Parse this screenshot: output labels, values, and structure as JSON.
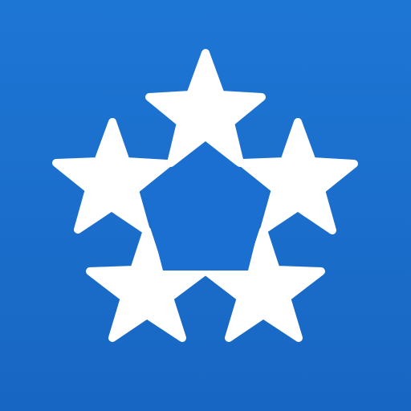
{
  "app_icon": {
    "name": "five-star-ring-icon",
    "background_color": "#1a6fd0",
    "star_color": "#ffffff",
    "star_count": 5
  }
}
